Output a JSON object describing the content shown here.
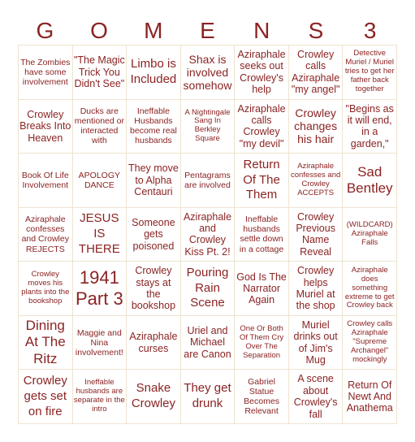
{
  "title_letters": [
    "G",
    "O",
    "M",
    "E",
    "N",
    "S",
    "3"
  ],
  "colors": {
    "text": "#8b2323",
    "border": "#eee3cf",
    "background": "#ffffff"
  },
  "cells": [
    [
      "The Zombies have some involvement",
      "\"The Magic Trick You Didn't See\"",
      "Limbo is Included",
      "Shax is involved somehow",
      "Aziraphale seeks out Crowley's help",
      "Crowley calls Aziraphale \"my angel\"",
      "Detective Muriel / Muriel tries to get her father back together"
    ],
    [
      "Crowley Breaks Into Heaven",
      "Ducks are mentioned or interacted with",
      "Ineffable Husbands become real husbands",
      "A Nightingale Sang In Berkley Square",
      "Aziraphale calls Crowley \"my devil\"",
      "Crowley changes his hair",
      "\"Begins as it will end, in a garden,\""
    ],
    [
      "Book Of Life Involvement",
      "APOLOGY DANCE",
      "They move to Alpha Centauri",
      "Pentagrams are involved",
      "Return Of The Them",
      "Aziraphale confesses and Crowley ACCEPTS",
      "Sad Bentley"
    ],
    [
      "Aziraphale confesses and Crowley REJECTS",
      "JESUS IS THERE",
      "Someone gets poisoned",
      "Aziraphale and Crowley Kiss Pt. 2!",
      "Ineffable husbands settle down in a cottage",
      "Crowley Previous Name Reveal",
      "(WILDCARD) Aziraphale Falls"
    ],
    [
      "Crowley moves his plants into the bookshop",
      "1941 Part 3",
      "Crowley stays at the bookshop",
      "Pouring Rain Scene",
      "God Is The Narrator Again",
      "Crowley helps Muriel at the shop",
      "Aziraphale does something extreme to get Crowley back"
    ],
    [
      "Dining At The Ritz",
      "Maggie and Nina involvement!",
      "Aziraphale curses",
      "Uriel and Michael are Canon",
      "One Or Both Of Them Cry Over The Separation",
      "Muriel drinks out of Jim's Mug",
      "Crowley calls Aziraphale \"Supreme Archangel\" mockingly"
    ],
    [
      "Crowley gets set on fire",
      "Ineffable husbands are separate in the intro",
      "Snake Crowley",
      "They get drunk",
      "Gabriel Statue Becomes Relevant",
      "A scene about Crowley's fall",
      "Return Of Newt And Anathema"
    ]
  ]
}
